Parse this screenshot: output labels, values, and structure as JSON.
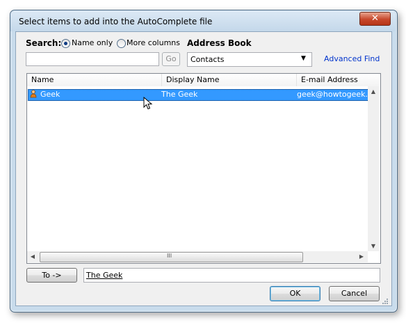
{
  "window": {
    "title": "Select items to add into the AutoComplete file",
    "close_glyph": "✕"
  },
  "search": {
    "label": "Search:",
    "options": [
      "Name only",
      "More columns"
    ],
    "selected": "Name only",
    "input_value": "",
    "go_label": "Go"
  },
  "address_book": {
    "label": "Address Book",
    "selected": "Contacts",
    "advanced_find": "Advanced Find"
  },
  "list": {
    "columns": [
      "Name",
      "Display Name",
      "E-mail Address"
    ],
    "rows": [
      {
        "name": "Geek",
        "display_name": "The Geek",
        "email": "geek@howtogeek.co",
        "icon": "contact-icon",
        "selected": true
      }
    ],
    "hscroll_grip": "III"
  },
  "to": {
    "button_label": "To ->",
    "value": "The Geek"
  },
  "buttons": {
    "ok": "OK",
    "cancel": "Cancel"
  }
}
